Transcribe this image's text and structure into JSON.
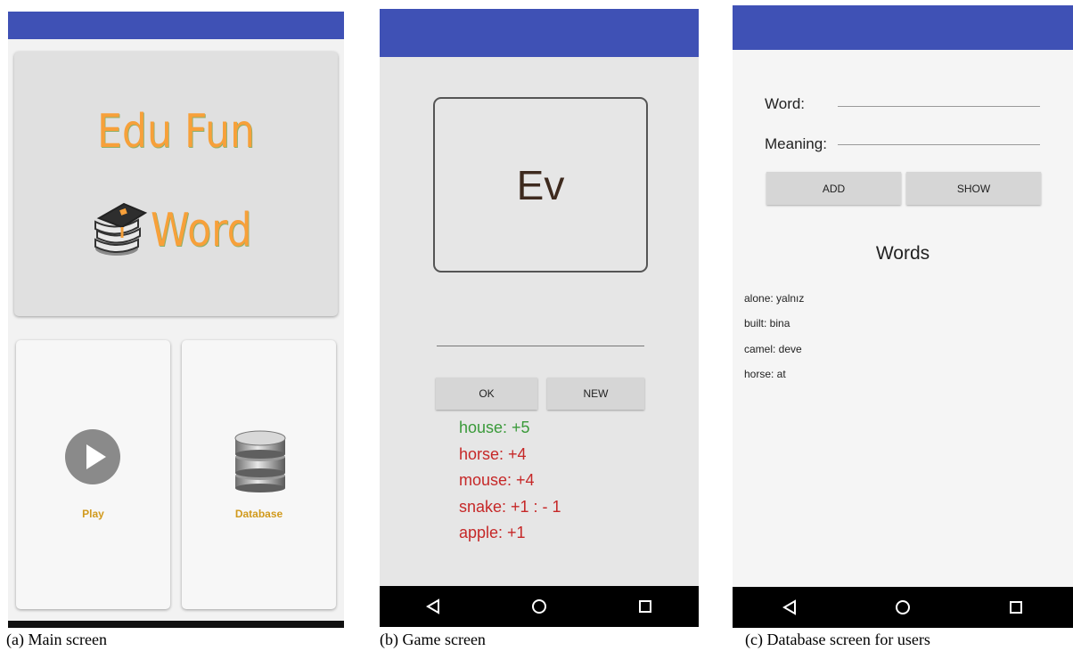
{
  "colors": {
    "app_bar": "#3f51b5",
    "logo_text": "#f7a03a",
    "menu_label": "#d19a1d",
    "score_correct": "#3a9a3a",
    "score_wrong": "#c62828"
  },
  "main_screen": {
    "logo_line1": "Edu Fun",
    "logo_line2": "Word",
    "play_label": "Play",
    "database_label": "Database",
    "caption": "(a) Main screen"
  },
  "game_screen": {
    "current_word": "Ev",
    "ok_label": "OK",
    "new_label": "NEW",
    "scores": [
      {
        "text": "house: +5",
        "status": "correct"
      },
      {
        "text": "horse: +4",
        "status": "wrong"
      },
      {
        "text": "mouse: +4",
        "status": "wrong"
      },
      {
        "text": "snake: +1 : - 1",
        "status": "wrong"
      },
      {
        "text": "apple: +1",
        "status": "wrong"
      }
    ],
    "caption": "(b) Game screen"
  },
  "database_screen": {
    "word_label": "Word:",
    "meaning_label": "Meaning:",
    "add_label": "ADD",
    "show_label": "SHOW",
    "words_title": "Words",
    "words": [
      "alone: yalnız",
      "built: bina",
      "camel: deve",
      "horse: at"
    ],
    "caption": "(c) Database screen for users"
  },
  "nav_icons": [
    "back-icon",
    "home-icon",
    "recents-icon"
  ]
}
